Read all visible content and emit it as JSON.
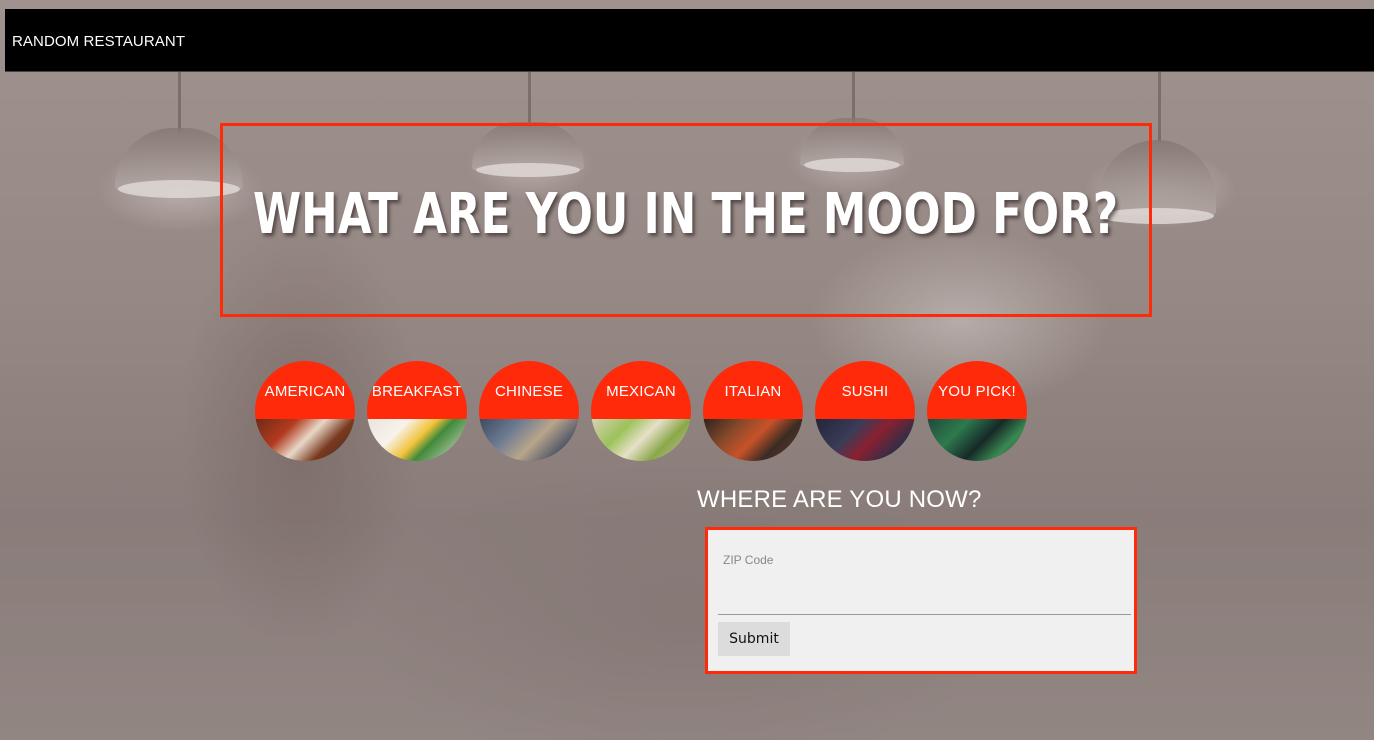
{
  "nav": {
    "brand": "RANDOM RESTAURANT"
  },
  "hero": {
    "title": "WHAT ARE YOU IN THE MOOD FOR?"
  },
  "categories": [
    {
      "label": "AMERICAN"
    },
    {
      "label": "BREAKFAST"
    },
    {
      "label": "CHINESE"
    },
    {
      "label": "MEXICAN"
    },
    {
      "label": "ITALIAN"
    },
    {
      "label": "SUSHI"
    },
    {
      "label": "YOU PICK!"
    }
  ],
  "location": {
    "heading": "WHERE ARE YOU NOW?",
    "zip_label": "ZIP Code",
    "zip_value": "",
    "submit_label": "Submit"
  },
  "colors": {
    "accent": "#ff2a0a",
    "navbar": "#000000",
    "form_bg": "#f0f0f0"
  }
}
